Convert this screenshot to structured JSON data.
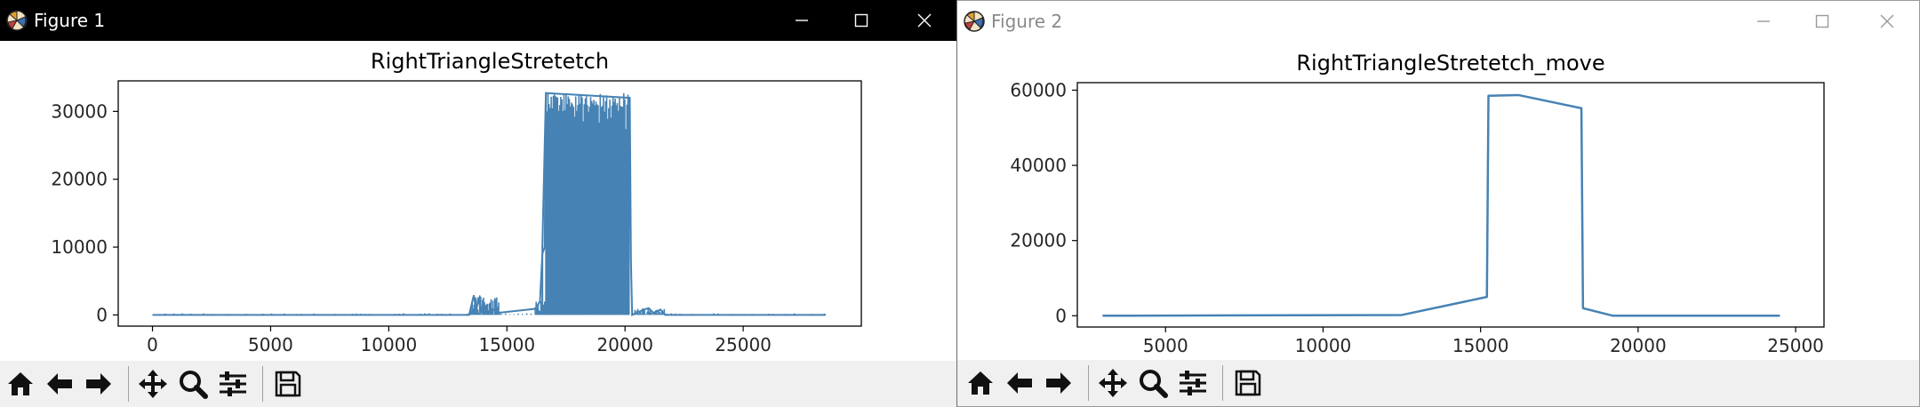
{
  "windows": [
    {
      "title": "Figure 1",
      "active": true
    },
    {
      "title": "Figure 2",
      "active": false
    }
  ],
  "icons": {
    "app": "matplotlib-logo-icon",
    "window_buttons": [
      "minimize-icon",
      "maximize-icon",
      "close-icon"
    ],
    "toolbar": [
      "home-icon",
      "back-arrow-icon",
      "forward-arrow-icon",
      "pan-move-icon",
      "zoom-magnifier-icon",
      "configure-subplots-icon",
      "save-floppy-icon"
    ]
  },
  "colors": {
    "series": "#4682b4",
    "titlebar_active": "#000000",
    "toolbar": "#f0f0f0"
  },
  "chart_data": [
    {
      "type": "line",
      "title": "RightTriangleStretetch",
      "xlabel": "",
      "ylabel": "",
      "xlim": [
        -1450,
        30000
      ],
      "ylim": [
        -1650,
        34500
      ],
      "xticks": [
        0,
        5000,
        10000,
        15000,
        20000,
        25000
      ],
      "yticks": [
        0,
        10000,
        20000,
        30000
      ],
      "grid": false,
      "series": [
        {
          "description_of_shape": "dense noisy signal, near 0 with small bursts around 13500-14500 and 16300-16500, then a dense high band up to about 32700 between about 16600 and 20300, then near 0 with a small burst near 21000",
          "x": [
            0,
            13400,
            13600,
            13700,
            13800,
            13900,
            14000,
            14200,
            14400,
            14600,
            16200,
            16400,
            16500,
            16600,
            16650,
            20200,
            20250,
            20300,
            20800,
            21000,
            21200,
            21500,
            21700,
            28500
          ],
          "y": [
            0,
            0,
            2900,
            500,
            2600,
            300,
            1800,
            400,
            900,
            300,
            900,
            2000,
            9000,
            10000,
            32700,
            32000,
            8000,
            0,
            800,
            1000,
            300,
            800,
            0,
            0
          ]
        }
      ]
    },
    {
      "type": "line",
      "title": "RightTriangleStretetch_move",
      "xlabel": "",
      "ylabel": "",
      "xlim": [
        2200,
        25900
      ],
      "ylim": [
        -3000,
        62000
      ],
      "xticks": [
        5000,
        10000,
        15000,
        20000,
        25000
      ],
      "yticks": [
        0,
        20000,
        40000,
        60000
      ],
      "grid": false,
      "series": [
        {
          "x": [
            3000,
            12500,
            15200,
            15250,
            16200,
            18200,
            18250,
            19200,
            24500
          ],
          "y": [
            0,
            200,
            5000,
            58500,
            58700,
            55200,
            2000,
            0,
            0
          ]
        }
      ]
    }
  ]
}
